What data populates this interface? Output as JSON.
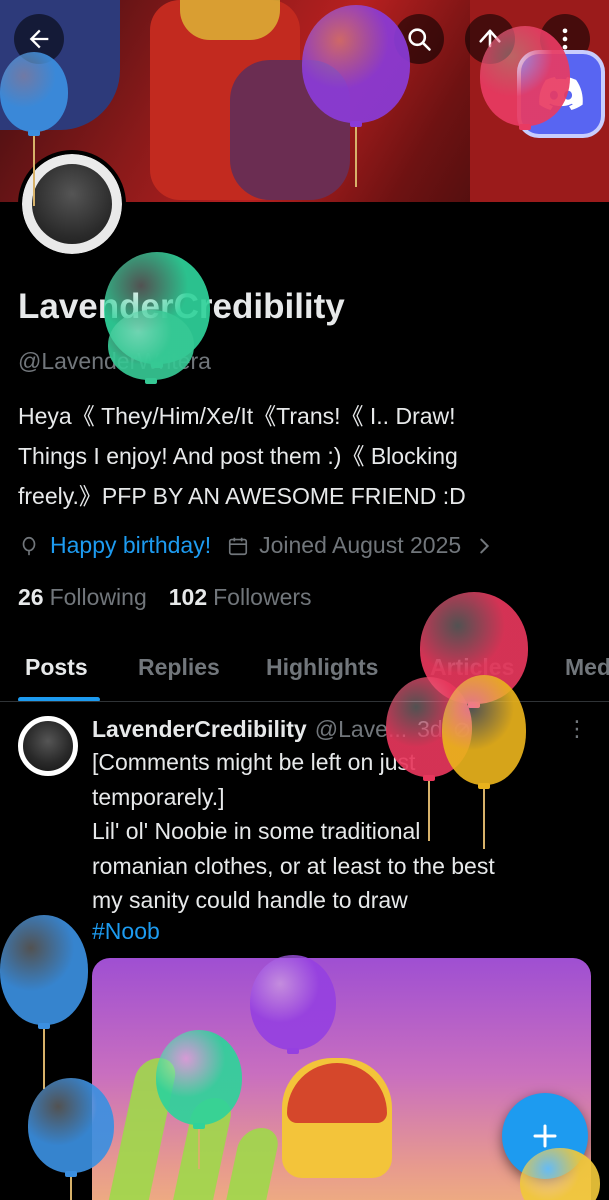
{
  "banner": {
    "back_icon": "arrow-left-icon",
    "search_icon": "search-icon",
    "share_icon": "share-icon",
    "more_icon": "more-vertical-icon",
    "discord_icon": "discord-icon"
  },
  "profile": {
    "display_name": "LavenderCredibility",
    "handle": "@LavenderWritera",
    "bio": "Heya《 They/Him/Xe/It《Trans!《 I.. Draw!\nThings I enjoy! And post them :)《 Blocking\nfreely.》PFP BY AN AWESOME FRIEND :D",
    "birthday": "Happy birthday!",
    "joined": "Joined August 2025",
    "following_count": "26",
    "following_label": "Following",
    "followers_count": "102",
    "followers_label": "Followers"
  },
  "tabs": [
    "Posts",
    "Replies",
    "Highlights",
    "Articles",
    "Media"
  ],
  "post": {
    "name": "LavenderCredibility",
    "handle": "@Lave...",
    "time": "3d",
    "text": "[Comments might be left on just\ntemporarely.]\nLil' ol' Noobie in some traditional\nromanian clothes, or at least to the best\nmy sanity could handle to draw",
    "hashtag": "#Noob"
  },
  "colors": {
    "accent": "#1d9bf0",
    "discord": "#5865F2",
    "background": "#000000",
    "muted": "#71767b"
  }
}
